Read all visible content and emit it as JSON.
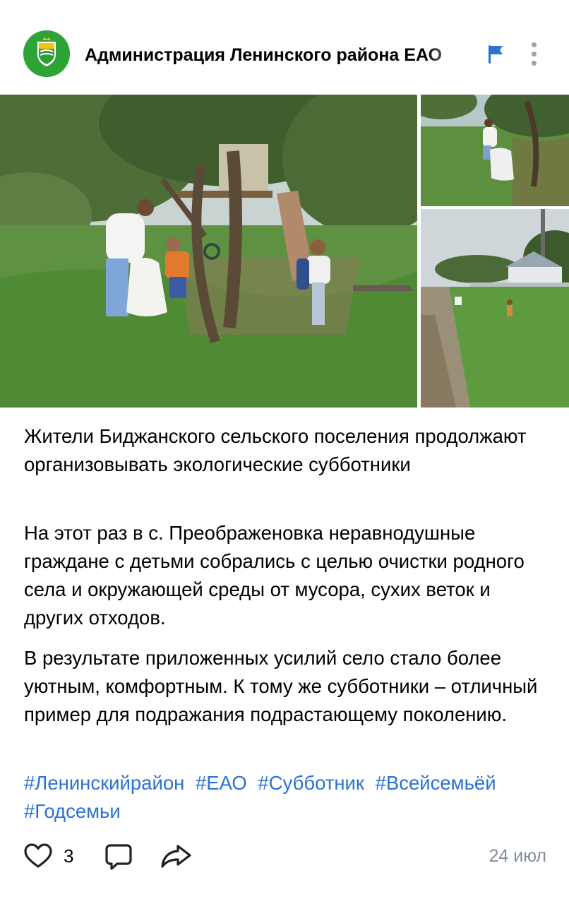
{
  "post": {
    "author": "Администрация Ленинского района ЕАО",
    "paragraphs": [
      "Жители Биджанского сельского поселения продолжают организовывать экологические субботники",
      "На этот раз в с. Преображеновка неравнодушные граждане с детьми собрались с целью очистки родного села и окружающей среды от мусора, сухих веток и других отходов.",
      "В результате приложенных усилий село стало более уютным, комфортным. К тому же субботники – отличный пример для подражания подрастающему поколению."
    ],
    "hashtags": [
      "#Ленинскийрайон",
      "#ЕАО",
      "#Субботник",
      "#Всейсемьёй",
      "#Годсемьи"
    ],
    "likes": "3",
    "date": "24 июл"
  },
  "colors": {
    "link": "#2a72d4",
    "muted": "#818c99",
    "avatar_bg": "#2ea336",
    "flag": "#2a72d4"
  },
  "icons": {
    "flag": "flag-icon",
    "more": "more-vertical-icon",
    "like": "heart-icon",
    "comment": "comment-icon",
    "share": "share-icon"
  }
}
